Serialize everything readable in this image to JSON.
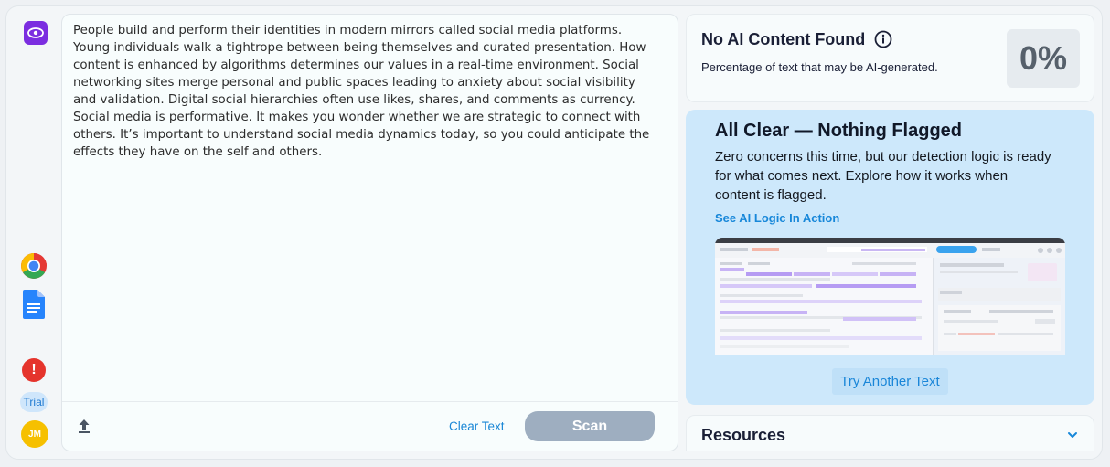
{
  "editor": {
    "text": "People build and perform their identities in modern mirrors called social media platforms. Young individuals walk a tightrope between being themselves and curated presentation. How content is enhanced by algorithms determines our values in a real-time environment. Social networking sites merge personal and public spaces leading to anxiety about social visibility and validation. Digital social hierarchies often use likes, shares, and comments as currency. Social media is performative. It makes you wonder whether we are strategic to connect with others. It’s important to understand social media dynamics today, so you could anticipate the effects they have on the self and others.",
    "clear_label": "Clear Text",
    "scan_label": "Scan"
  },
  "rail": {
    "trial_label": "Trial",
    "avatar_initials": "JM",
    "alert_glyph": "!"
  },
  "result": {
    "title": "No AI Content Found",
    "subtitle": "Percentage of text that may be AI-generated.",
    "percent": "0%"
  },
  "all_clear": {
    "title": "All Clear — Nothing Flagged",
    "body": "Zero concerns this time, but our detection logic is ready for what comes next. Explore how it works when content is flagged.",
    "link": "See AI Logic In Action",
    "try_label": "Try Another Text"
  },
  "resources": {
    "title": "Resources"
  },
  "colors": {
    "brand": "#7b2de0",
    "accent_link": "#1787d9",
    "panel_blue": "#cde8fb",
    "scan_disabled": "#9eaec0"
  }
}
